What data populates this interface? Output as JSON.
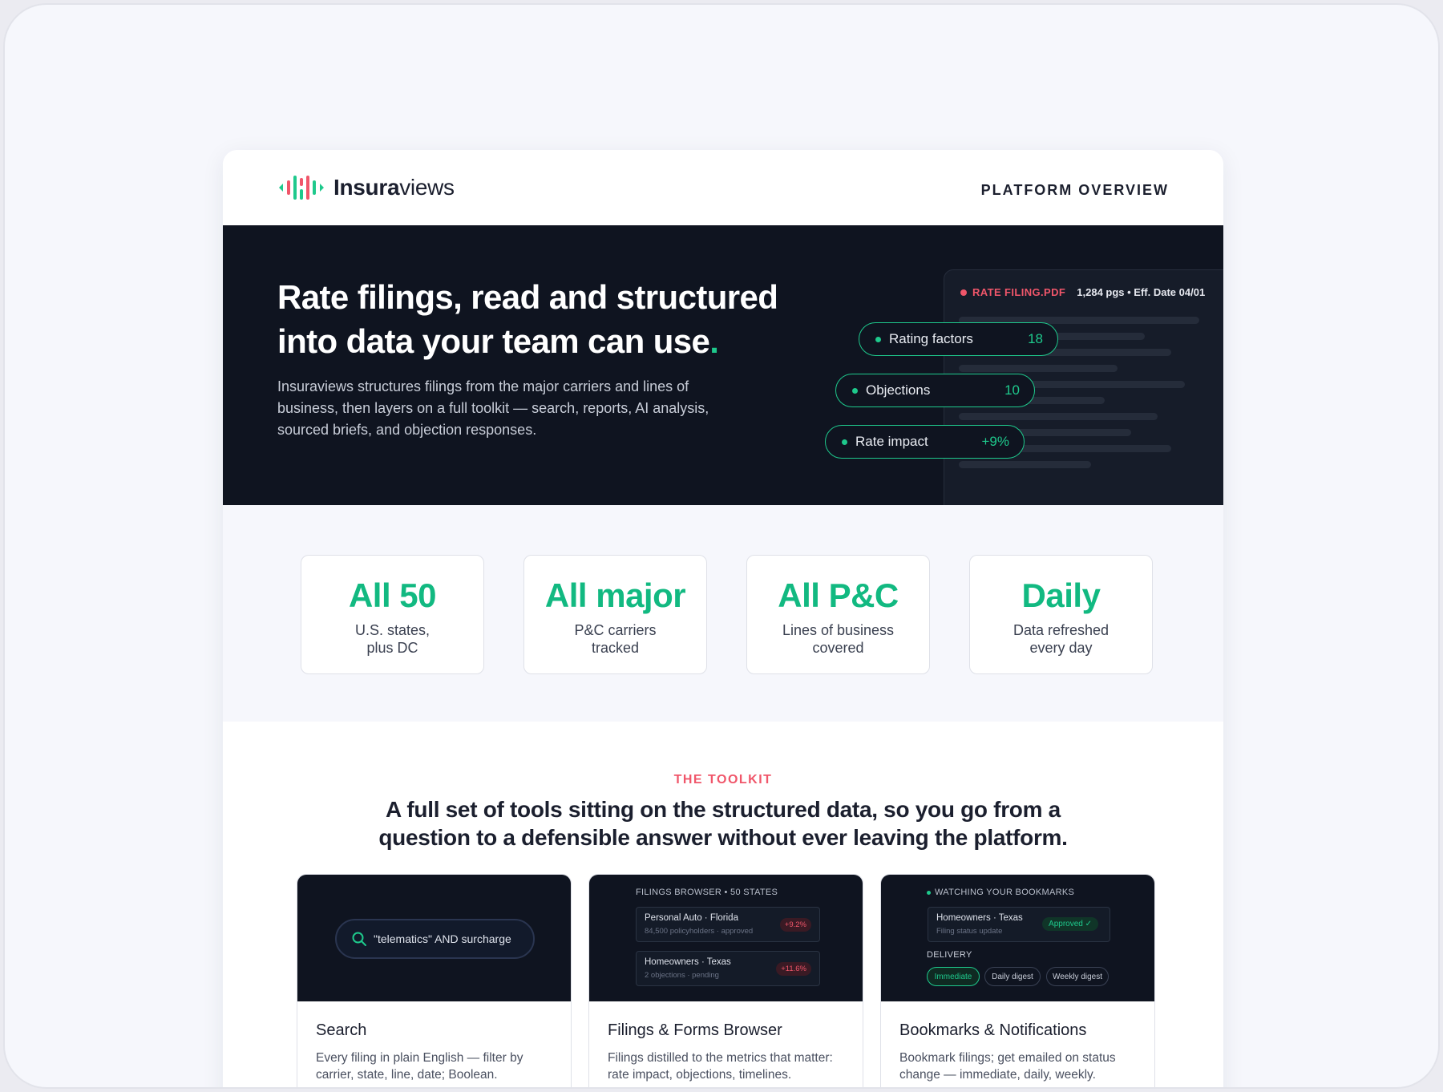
{
  "brand": {
    "name_bold": "Insura",
    "name_light": "views",
    "logo_icon": "bars-logo-icon"
  },
  "header": {
    "right_label": "PLATFORM OVERVIEW"
  },
  "hero": {
    "title": "Rate filings, read and structured into data your team can use",
    "title_dot": ".",
    "description": "Insuraviews structures filings from the major carriers and lines of business, then layers on a full toolkit — search, reports, AI analysis, sourced briefs, and objection responses.",
    "pdf": {
      "name": "RATE FILING.PDF",
      "meta": "1,284 pgs • Eff. Date 04/01"
    },
    "pills": [
      {
        "label": "Rating factors",
        "value": "18"
      },
      {
        "label": "Objections",
        "value": "10"
      },
      {
        "label": "Rate impact",
        "value": "+9%"
      }
    ]
  },
  "stats": [
    {
      "big": "All 50",
      "sub1": "U.S. states,",
      "sub2": "plus DC"
    },
    {
      "big": "All major",
      "sub1": "P&C carriers",
      "sub2": "tracked"
    },
    {
      "big": "All P&C",
      "sub1": "Lines of business",
      "sub2": "covered"
    },
    {
      "big": "Daily",
      "sub1": "Data refreshed",
      "sub2": "every day"
    }
  ],
  "toolkit": {
    "eyebrow": "THE TOOLKIT",
    "title": "A full set of tools sitting on the structured data, so you go from a question to a defensible answer without ever leaving the platform.",
    "cards": [
      {
        "title": "Search",
        "desc": "Every filing in plain English — filter by carrier, state, line, date; Boolean.",
        "query": "\"telematics\" AND surcharge"
      },
      {
        "title": "Filings & Forms Browser",
        "desc": "Filings distilled to the metrics that matter: rate impact, objections, timelines.",
        "head": "FILINGS BROWSER • 50 STATES",
        "rows": [
          {
            "title": "Personal Auto · Florida",
            "sub": "84,500 policyholders · approved",
            "badge": "+9.2%"
          },
          {
            "title": "Homeowners · Texas",
            "sub": "2 objections · pending",
            "badge": "+11.6%"
          }
        ]
      },
      {
        "title": "Bookmarks & Notifications",
        "desc": "Bookmark filings; get emailed on status change — immediate, daily, weekly.",
        "head": "WATCHING YOUR BOOKMARKS",
        "row": {
          "title": "Homeowners · Texas",
          "sub": "Filing status update",
          "badge": "Approved ✓"
        },
        "delivery_label": "DELIVERY",
        "chips": [
          "Immediate",
          "Daily digest",
          "Weekly digest"
        ]
      }
    ]
  },
  "colors": {
    "accent_green": "#1ec98c",
    "accent_red": "#f0566a",
    "dark": "#0f1420"
  }
}
